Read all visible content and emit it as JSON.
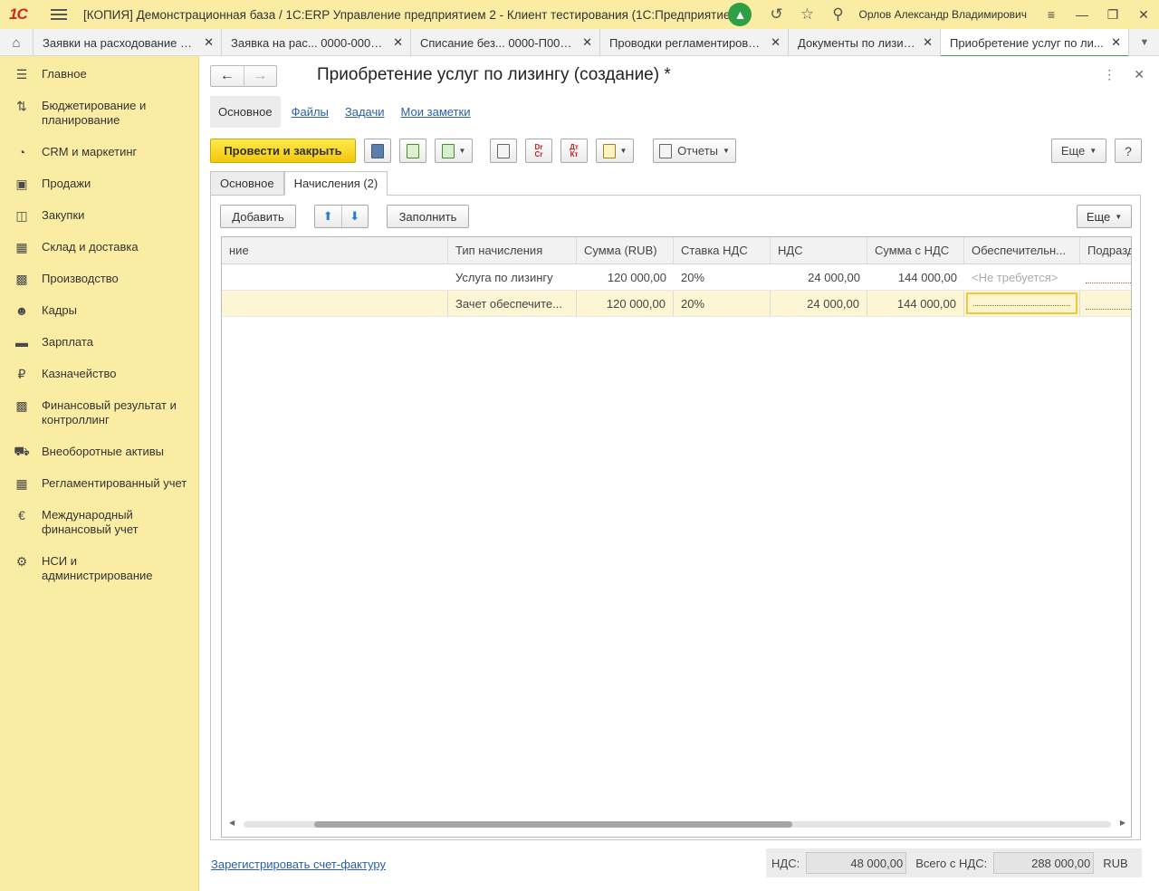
{
  "titlebar": {
    "logo": "1С",
    "title": "[КОПИЯ] Демонстрационная база / 1С:ERP Управление предприятием 2  - Клиент тестирования (1С:Предприятие)",
    "user": "Орлов Александр Владимирович"
  },
  "tabs": [
    {
      "label": "Заявки на расходование д..."
    },
    {
      "label": "Заявка на рас... 0000-000009"
    },
    {
      "label": "Списание без... 0000-П00008"
    },
    {
      "label": "Проводки регламентирова..."
    },
    {
      "label": "Документы по лизингу"
    },
    {
      "label": "Приобретение услуг по ли..."
    }
  ],
  "sidebar": {
    "items": [
      {
        "label": "Главное",
        "icon": "menu-icon"
      },
      {
        "label": "Бюджетирование и планирование",
        "icon": "budget-icon"
      },
      {
        "label": "CRM и маркетинг",
        "icon": "crm-icon"
      },
      {
        "label": "Продажи",
        "icon": "sales-icon"
      },
      {
        "label": "Закупки",
        "icon": "cart-icon"
      },
      {
        "label": "Склад и доставка",
        "icon": "warehouse-icon"
      },
      {
        "label": "Производство",
        "icon": "factory-icon"
      },
      {
        "label": "Кадры",
        "icon": "person-icon"
      },
      {
        "label": "Зарплата",
        "icon": "wallet-icon"
      },
      {
        "label": "Казначейство",
        "icon": "ruble-icon"
      },
      {
        "label": "Финансовый результат и контроллинг",
        "icon": "chart-icon"
      },
      {
        "label": "Внеоборотные активы",
        "icon": "truck-icon"
      },
      {
        "label": "Регламентированный учет",
        "icon": "calculator-icon"
      },
      {
        "label": "Международный финансовый учет",
        "icon": "euro-icon"
      },
      {
        "label": "НСИ и администрирование",
        "icon": "gear-icon"
      }
    ]
  },
  "document": {
    "title": "Приобретение услуг по лизингу (создание) *",
    "section_tabs": [
      "Основное",
      "Файлы",
      "Задачи",
      "Мои заметки"
    ],
    "toolbar": {
      "post_close": "Провести и закрыть",
      "dr_cr": "Dr\nCr",
      "dt_kt": "Дт\nКт",
      "reports": "Отчеты",
      "more": "Еще",
      "help": "?"
    },
    "form_tabs": [
      "Основное",
      "Начисления (2)"
    ],
    "table_toolbar": {
      "add": "Добавить",
      "fill": "Заполнить",
      "more": "Еще"
    },
    "columns": [
      "ние",
      "Тип начисления",
      "Сумма (RUB)",
      "Ставка НДС",
      "НДС",
      "Сумма с НДС",
      "Обеспечительн...",
      "Подразд"
    ],
    "rows": [
      {
        "name": "",
        "type": "Услуга по лизингу",
        "sum": "120 000,00",
        "rate": "20%",
        "vat": "24 000,00",
        "total": "144 000,00",
        "security": "<Не требуется>"
      },
      {
        "name": "",
        "type": "Зачет обеспечите...",
        "sum": "120 000,00",
        "rate": "20%",
        "vat": "24 000,00",
        "total": "144 000,00",
        "security": ""
      }
    ],
    "footer": {
      "invoice_link": "Зарегистрировать счет-фактуру",
      "vat_label": "НДС:",
      "vat_value": "48 000,00",
      "total_label": "Всего с НДС:",
      "total_value": "288 000,00",
      "currency": "RUB"
    }
  }
}
